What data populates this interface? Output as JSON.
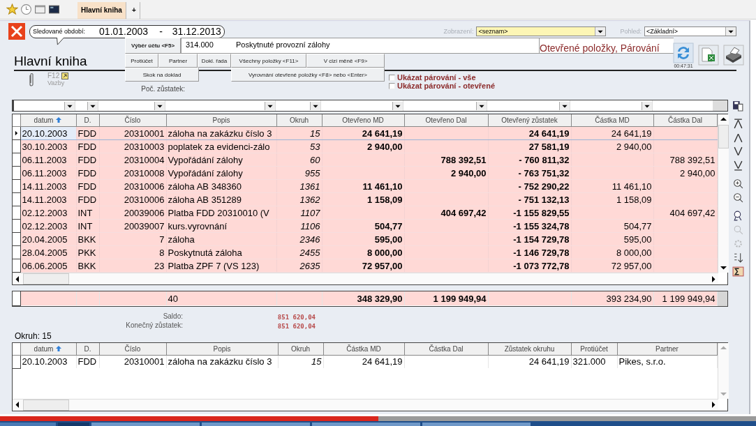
{
  "tabs": [
    {
      "label": "Hlavní kniha",
      "selected": true
    },
    {
      "label": "+",
      "selected": false
    }
  ],
  "period": {
    "label": "Sledované období:",
    "from": "01.01.2003",
    "separator": "-",
    "to": "31.12.2013"
  },
  "display": {
    "label": "Zobrazení:",
    "value": "<seznam>"
  },
  "view": {
    "label": "Pohled:",
    "value": "<Základní>"
  },
  "title": "Hlavní kniha",
  "account": {
    "button": "Výběr účtu <F5>",
    "number": "314.000",
    "name": "Poskytnuté provozní zálohy"
  },
  "mode_label": "Otevřené položky, Párování",
  "refresh_time": "00:47:31",
  "button_rows": [
    [
      "Protiúčet",
      "Partner",
      "Dokl. řada",
      "Všechny položky <F11>",
      "V cizí měně <F9>"
    ],
    [
      "Skok na doklad",
      "Vyrovnání otevřené položky <F8> nebo <Enter>"
    ]
  ],
  "links": {
    "key": "F12",
    "label": "Vazby"
  },
  "opening_balance_label": "Poč. zůstatek:",
  "checkboxes": [
    {
      "label": "Ukázat párování - vše",
      "checked": false
    },
    {
      "label": "Ukázat párování - otevřené",
      "checked": false
    }
  ],
  "main_table": {
    "columns": [
      {
        "label": "datum",
        "sorted": true,
        "filter": true
      },
      {
        "label": "D.",
        "sorted": false,
        "filter": true
      },
      {
        "label": "Číslo",
        "sorted": false,
        "filter": true
      },
      {
        "label": "Popis",
        "sorted": false,
        "filter": true
      },
      {
        "label": "Okruh",
        "sorted": false,
        "filter": true
      },
      {
        "label": "Otevřeno MD",
        "sorted": false,
        "filter": true
      },
      {
        "label": "Otevřeno Dal",
        "sorted": false,
        "filter": true
      },
      {
        "label": "Otevřený zůstatek",
        "sorted": false,
        "filter": true
      },
      {
        "label": "Částka MD",
        "sorted": false,
        "filter": true
      },
      {
        "label": "Částka Dal",
        "sorted": false,
        "filter": false
      }
    ],
    "rows": [
      {
        "selected": true,
        "cells": [
          "20.10.2003",
          "FDD",
          "20310001",
          "záloha na zakázku číslo 3",
          "15",
          "24 641,19",
          null,
          "24 641,19",
          "24 641,19",
          null
        ]
      },
      {
        "selected": false,
        "cells": [
          "30.10.2003",
          "FDD",
          "20310003",
          "poplatek za evidenci-zálo",
          "53",
          "2 940,00",
          null,
          "27 581,19",
          "2 940,00",
          null
        ]
      },
      {
        "selected": false,
        "cells": [
          "06.11.2003",
          "FDD",
          "20310004",
          "Vypořádání zálohy",
          "60",
          null,
          "788 392,51",
          "- 760 811,32",
          null,
          "788 392,51"
        ]
      },
      {
        "selected": false,
        "cells": [
          "06.11.2003",
          "FDD",
          "20310008",
          "Vypořádání zálohy",
          "955",
          null,
          "2 940,00",
          "- 763 751,32",
          null,
          "2 940,00"
        ]
      },
      {
        "selected": false,
        "cells": [
          "14.11.2003",
          "FDD",
          "20310006",
          "záloha AB 348360",
          "1361",
          "11 461,10",
          null,
          "- 752 290,22",
          "11 461,10",
          null
        ]
      },
      {
        "selected": false,
        "cells": [
          "14.11.2003",
          "FDD",
          "20310006",
          "záloha AB 351289",
          "1362",
          "1 158,09",
          null,
          "- 751 132,13",
          "1 158,09",
          null
        ]
      },
      {
        "selected": false,
        "cells": [
          "02.12.2003",
          "INT",
          "20039006",
          "Platba FDD 20310010  (V",
          "1107",
          null,
          "404 697,42",
          "-1 155 829,55",
          null,
          "404 697,42"
        ]
      },
      {
        "selected": false,
        "cells": [
          "02.12.2003",
          "INT",
          "20039007",
          "kurs.vyrovnání",
          "1106",
          "504,77",
          null,
          "-1 155 324,78",
          "504,77",
          null
        ]
      },
      {
        "selected": false,
        "cells": [
          "20.04.2005",
          "BKK",
          "7",
          "záloha",
          "2346",
          "595,00",
          null,
          "-1 154 729,78",
          "595,00",
          null
        ]
      },
      {
        "selected": false,
        "cells": [
          "28.04.2005",
          "PKK",
          "8",
          "Poskytnutá záloha",
          "2455",
          "8 000,00",
          null,
          "-1 146 729,78",
          "8 000,00",
          null
        ]
      },
      {
        "selected": false,
        "cells": [
          "06.06.2005",
          "BKK",
          "23",
          "Platba ZPF 7  (VS 123)",
          "2635",
          "72 957,00",
          null,
          "-1 073 772,78",
          "72 957,00",
          null
        ]
      }
    ]
  },
  "totals_table": {
    "rows": [
      {
        "cells": [
          null,
          null,
          null,
          "40",
          null,
          "348 329,90",
          "1 199 949,94",
          null,
          "393 234,90",
          "1 199 949,94"
        ]
      }
    ]
  },
  "summary": [
    {
      "label": "Saldo:",
      "value": "851 620,04"
    },
    {
      "label": "Konečný zůstatek:",
      "value": "851 620,04"
    }
  ],
  "detail": {
    "title": "Okruh: 15",
    "columns": [
      {
        "label": "datum",
        "sorted": true
      },
      {
        "label": "D.",
        "sorted": false
      },
      {
        "label": "Číslo",
        "sorted": false
      },
      {
        "label": "Popis",
        "sorted": false
      },
      {
        "label": "Okruh",
        "sorted": false
      },
      {
        "label": "Částka MD",
        "sorted": false
      },
      {
        "label": "Částka Dal",
        "sorted": false
      },
      {
        "label": "Zůstatek okruhu",
        "sorted": false
      },
      {
        "label": "Protiúčet",
        "sorted": false
      },
      {
        "label": "Partner",
        "sorted": false
      }
    ],
    "rows": [
      {
        "cells": [
          "20.10.2003",
          "FDD",
          "20310001",
          "záloha na zakázku číslo 3",
          "15",
          "24 641,19",
          null,
          "24 641,19",
          "321.000",
          "Pikes, s.r.o."
        ]
      }
    ]
  },
  "video_progress": {
    "level": 0.5
  }
}
